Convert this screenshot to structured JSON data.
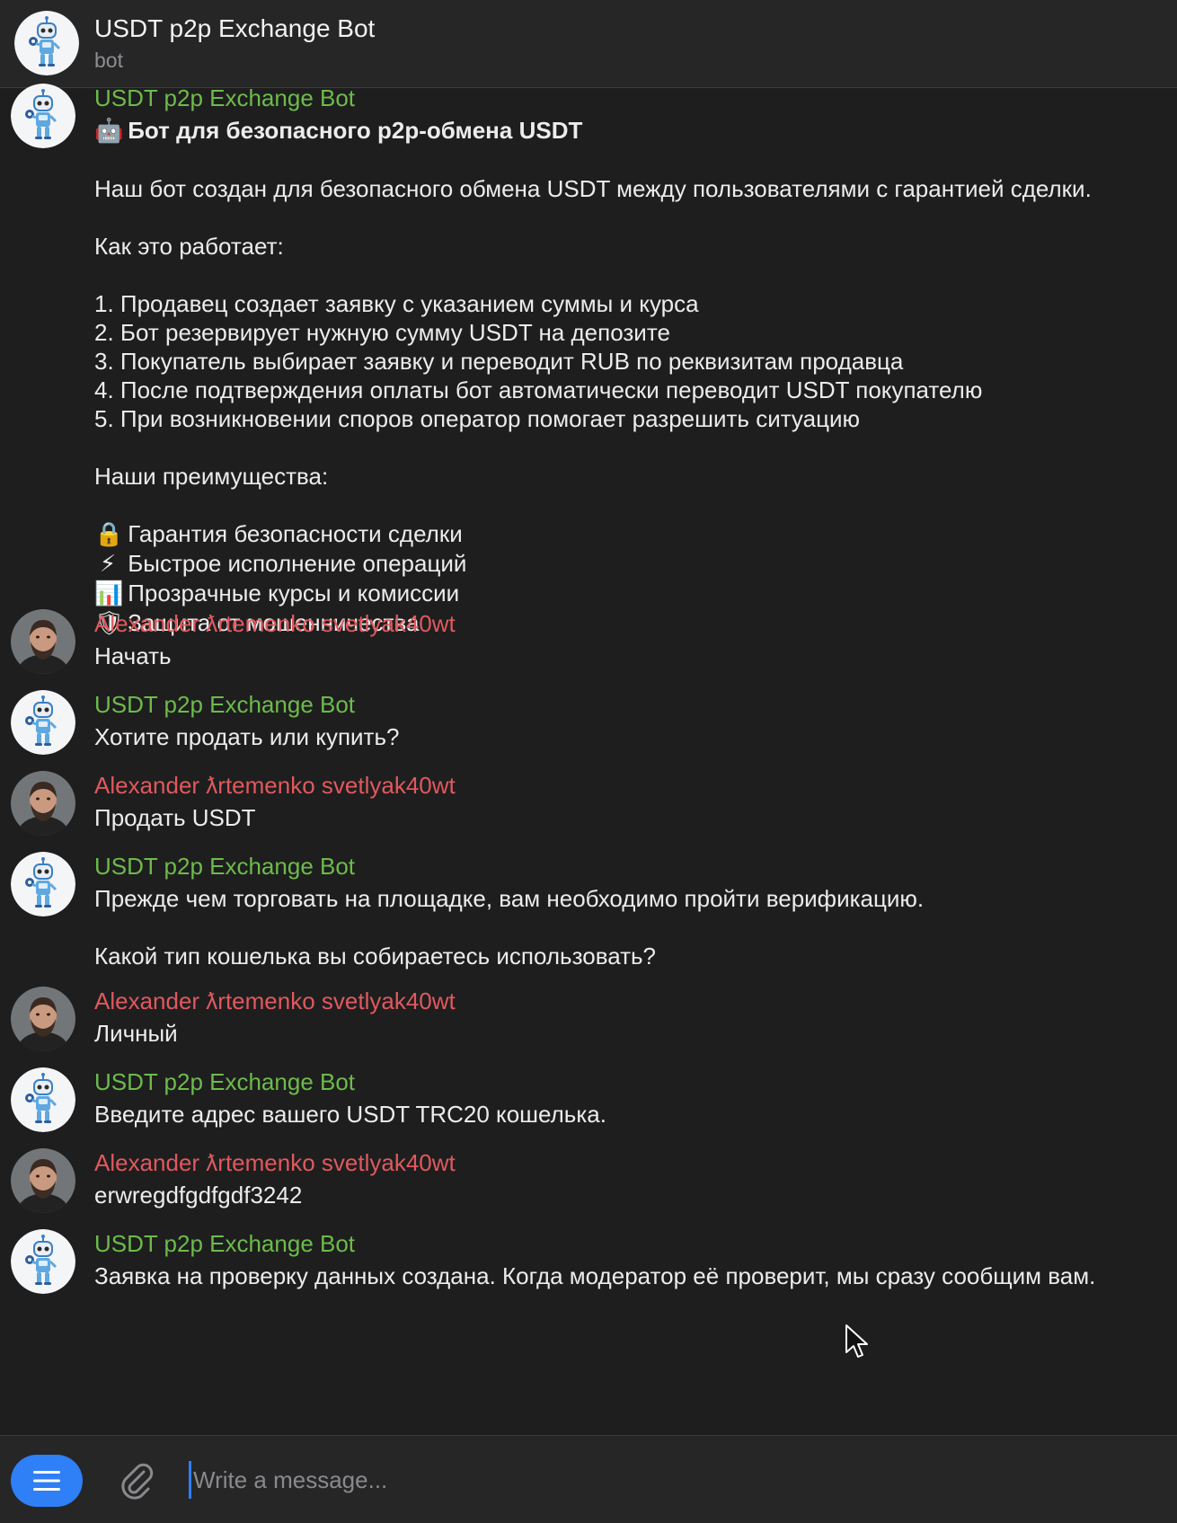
{
  "header": {
    "title": "USDT p2p Exchange Bot",
    "subtitle": "bot"
  },
  "messages": [
    {
      "sender": "USDT p2p Exchange Bot",
      "role": "bot",
      "lines": [
        {
          "emoji": "🤖",
          "text": "Бот для безопасного р2р-обмена USDT",
          "bold": true
        },
        {
          "text": ""
        },
        {
          "text": "Наш бот создан для безопасного обмена USDT между пользователями с гарантией сделки."
        },
        {
          "text": ""
        },
        {
          "text": "Как это работает:"
        },
        {
          "text": ""
        },
        {
          "text": "1. Продавец создает заявку с указанием суммы и курса"
        },
        {
          "text": "2. Бот резервирует нужную сумму USDT на депозите"
        },
        {
          "text": "3. Покупатель выбирает заявку и переводит RUB по реквизитам продавца"
        },
        {
          "text": "4. После подтверждения оплаты бот автоматически переводит USDT покупателю"
        },
        {
          "text": "5. При возникновении споров оператор помогает разрешить ситуацию"
        },
        {
          "text": ""
        },
        {
          "text": "Наши преимущества:"
        },
        {
          "text": ""
        },
        {
          "emoji": "🔒",
          "text": "Гарантия безопасности сделки"
        },
        {
          "emoji": "⚡",
          "text": "Быстрое исполнение операций"
        },
        {
          "emoji": "📊",
          "text": "Прозрачные курсы и комиссии"
        },
        {
          "emoji": "🛡",
          "text": "Защита от мошенничества"
        }
      ]
    },
    {
      "sender": "Alexander ƛrtemenko svetlyak40wt",
      "role": "user",
      "lines": [
        {
          "text": "Начать"
        }
      ]
    },
    {
      "sender": "USDT p2p Exchange Bot",
      "role": "bot",
      "lines": [
        {
          "text": "Хотите продать или купить?"
        }
      ]
    },
    {
      "sender": "Alexander ƛrtemenko svetlyak40wt",
      "role": "user",
      "lines": [
        {
          "text": "Продать USDT"
        }
      ]
    },
    {
      "sender": "USDT p2p Exchange Bot",
      "role": "bot",
      "lines": [
        {
          "text": "Прежде чем торговать на площадке, вам необходимо пройти верификацию."
        },
        {
          "text": ""
        },
        {
          "text": "Какой тип кошелька вы собираетесь использовать?"
        }
      ]
    },
    {
      "sender": "Alexander ƛrtemenko svetlyak40wt",
      "role": "user",
      "lines": [
        {
          "text": "Личный"
        }
      ]
    },
    {
      "sender": "USDT p2p Exchange Bot",
      "role": "bot",
      "lines": [
        {
          "text": "Введите адрес вашего USDT TRC20 кошелька."
        }
      ]
    },
    {
      "sender": "Alexander ƛrtemenko svetlyak40wt",
      "role": "user",
      "lines": [
        {
          "text": "erwregdfgdfgdf3242"
        }
      ]
    },
    {
      "sender": "USDT p2p Exchange Bot",
      "role": "bot",
      "lines": [
        {
          "text": "Заявка на проверку данных создана. Когда модератор её проверит, мы сразу сообщим вам."
        }
      ]
    }
  ],
  "composer": {
    "placeholder": "Write a message..."
  },
  "icons": {
    "menu": "menu-icon",
    "attach": "paperclip-icon"
  },
  "colors": {
    "bot_name": "#6dbb4a",
    "user_name": "#e0595d",
    "accent": "#2f7ff6",
    "background": "#1e1e1f"
  }
}
